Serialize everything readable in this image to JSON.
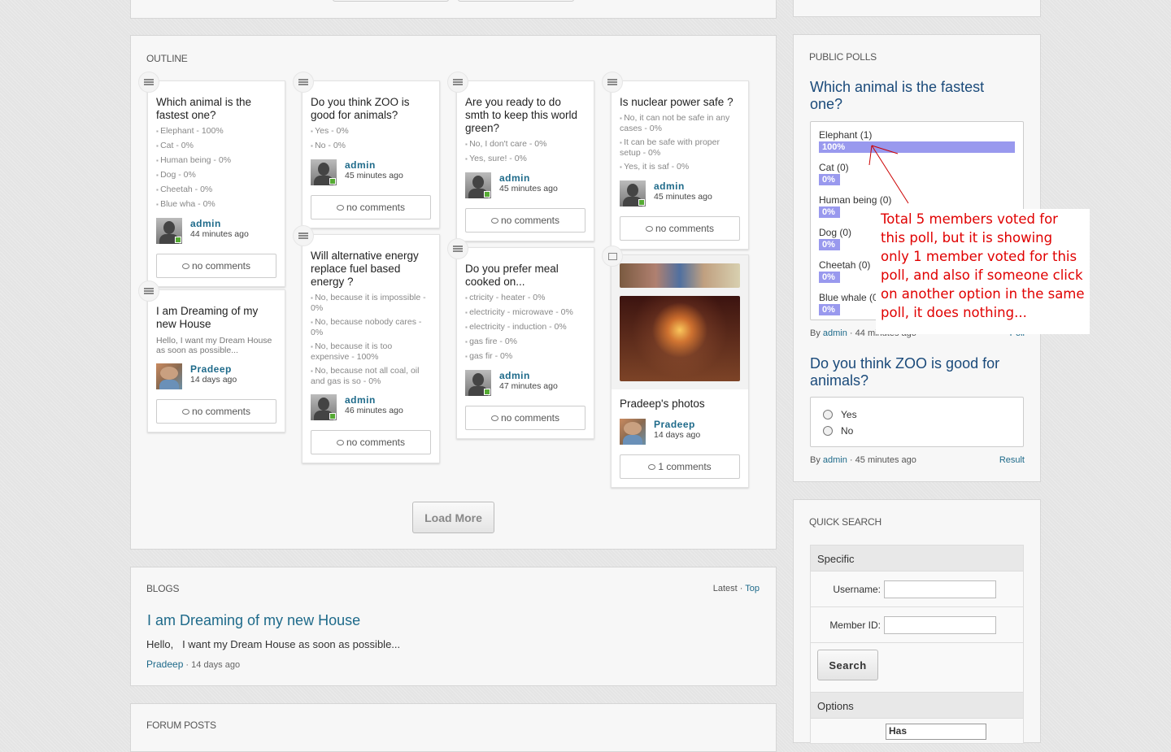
{
  "outline": {
    "title": "OUTLINE",
    "load_more": "Load More",
    "cards": [
      {
        "type": "poll",
        "title": "Which animal is the fastest one?",
        "options": [
          "Elephant - 100%",
          "Cat - 0%",
          "Human being - 0%",
          "Dog - 0%",
          "Cheetah - 0%",
          "Blue wha - 0%"
        ],
        "author": "admin",
        "time": "44 minutes ago",
        "comments": "no comments"
      },
      {
        "type": "blog",
        "title": "I am Dreaming of my new House",
        "snippet": "Hello,   I want my Dream House as soon as possible...",
        "author": "Pradeep",
        "time": "14 days ago",
        "comments": "no comments"
      },
      {
        "type": "poll",
        "title": "Do you think ZOO is good for animals?",
        "options": [
          "Yes - 0%",
          "No - 0%"
        ],
        "author": "admin",
        "time": "45 minutes ago",
        "comments": "no comments"
      },
      {
        "type": "poll",
        "title": "Will alternative energy replace fuel based energy ?",
        "options": [
          "No, because it is impossible - 0%",
          "No, because nobody cares - 0%",
          "No, because it is too expensive - 100%",
          "No, because not all coal, oil and gas is so - 0%"
        ],
        "author": "admin",
        "time": "46 minutes ago",
        "comments": "no comments"
      },
      {
        "type": "poll",
        "title": "Are you ready to do smth to keep this world green?",
        "options": [
          "No, I don't care - 0%",
          "Yes, sure! - 0%"
        ],
        "author": "admin",
        "time": "45 minutes ago",
        "comments": "no comments"
      },
      {
        "type": "poll",
        "title": "Do you prefer meal cooked on...",
        "options": [
          "ctricity - heater - 0%",
          "electricity - microwave - 0%",
          "electricity - induction - 0%",
          "gas fire - 0%",
          "gas fir - 0%"
        ],
        "author": "admin",
        "time": "47 minutes ago",
        "comments": "no comments"
      },
      {
        "type": "poll",
        "title": "Is nuclear power safe ?",
        "options": [
          "No, it can not be safe in any cases - 0%",
          "It can be safe with proper setup - 0%",
          "Yes, it is saf - 0%"
        ],
        "author": "admin",
        "time": "45 minutes ago",
        "comments": "no comments"
      },
      {
        "type": "photo",
        "title": "Pradeep's photos",
        "author": "Pradeep",
        "time": "14 days ago",
        "comments": "1 comments"
      }
    ]
  },
  "blogs": {
    "title": "BLOGS",
    "filter_latest": "Latest",
    "filter_sep": " · ",
    "filter_top": "Top",
    "post_title": "I am Dreaming of my new House",
    "post_snippet": "Hello,   I want my Dream House as soon as possible...",
    "post_author": "Pradeep",
    "post_time": " · 14 days ago"
  },
  "forum": {
    "title": "FORUM POSTS"
  },
  "polls": {
    "title": "PUBLIC POLLS",
    "poll1": {
      "question": "Which animal is the fastest one?",
      "results": [
        {
          "label": "Elephant (1)",
          "pct": 100,
          "text": "100%"
        },
        {
          "label": "Cat (0)",
          "pct": 0,
          "text": "0%"
        },
        {
          "label": "Human being (0)",
          "pct": 0,
          "text": "0%"
        },
        {
          "label": "Dog (0)",
          "pct": 0,
          "text": "0%"
        },
        {
          "label": "Cheetah (0)",
          "pct": 0,
          "text": "0%"
        },
        {
          "label": "Blue whale (0)",
          "pct": 0,
          "text": "0%"
        }
      ],
      "by": "By ",
      "author": "admin",
      "time": " · 44 minutes ago",
      "link": "Poll"
    },
    "poll2": {
      "question": "Do you think ZOO is good for animals?",
      "options": [
        "Yes",
        "No"
      ],
      "by": "By ",
      "author": "admin",
      "time": " · 45 minutes ago",
      "link": "Result"
    }
  },
  "quick_search": {
    "title": "QUICK SEARCH",
    "specific": "Specific",
    "username_label": "Username:",
    "username_value": "",
    "member_id_label": "Member ID:",
    "member_id_value": "",
    "search_button": "Search",
    "options": "Options",
    "select_value": "Has"
  },
  "annotation": "Total 5 members voted for this poll, but it is showing only 1 member voted for this poll, and also if someone click on another option in the same poll, it does nothing..."
}
